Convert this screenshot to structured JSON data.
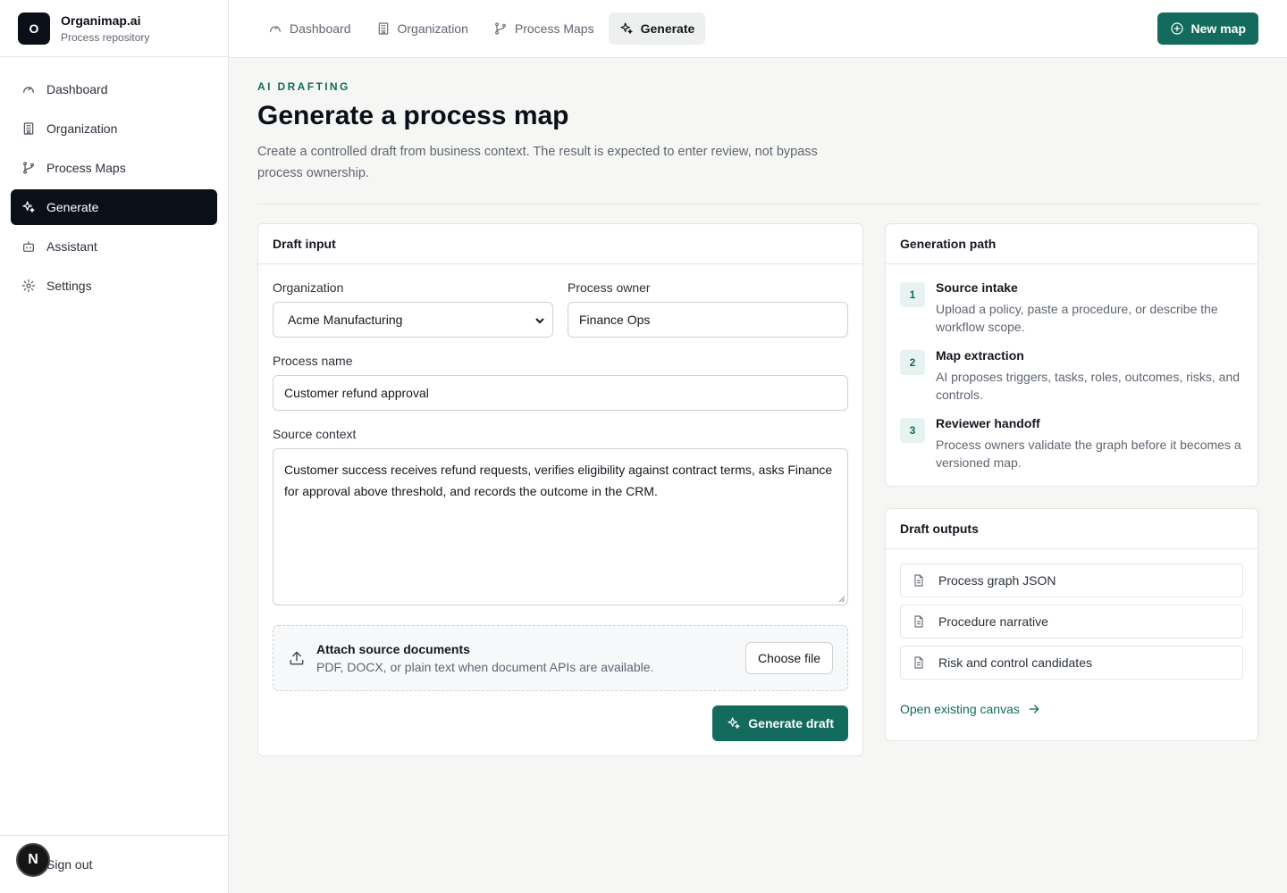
{
  "brand": {
    "logo_letter": "O",
    "name": "Organimap.ai",
    "subtitle": "Process repository"
  },
  "sidebar": {
    "items": [
      {
        "label": "Dashboard",
        "icon": "gauge-icon"
      },
      {
        "label": "Organization",
        "icon": "building-icon"
      },
      {
        "label": "Process Maps",
        "icon": "git-branch-icon"
      },
      {
        "label": "Generate",
        "icon": "sparkles-icon",
        "active": true
      },
      {
        "label": "Assistant",
        "icon": "bot-icon"
      },
      {
        "label": "Settings",
        "icon": "gear-icon"
      }
    ],
    "avatar_letter": "N",
    "sign_out": "Sign out"
  },
  "topbar": {
    "tabs": [
      {
        "label": "Dashboard",
        "icon": "gauge-icon"
      },
      {
        "label": "Organization",
        "icon": "building-icon"
      },
      {
        "label": "Process Maps",
        "icon": "git-branch-icon"
      },
      {
        "label": "Generate",
        "icon": "sparkles-icon",
        "active": true
      }
    ],
    "new_map_label": "New map"
  },
  "header": {
    "eyebrow": "AI DRAFTING",
    "title": "Generate a process map",
    "description": "Create a controlled draft from business context. The result is expected to enter review, not bypass process ownership."
  },
  "draft": {
    "title": "Draft input",
    "organization_label": "Organization",
    "organization_value": "Acme Manufacturing",
    "owner_label": "Process owner",
    "owner_value": "Finance Ops",
    "name_label": "Process name",
    "name_value": "Customer refund approval",
    "context_label": "Source context",
    "context_value": "Customer success receives refund requests, verifies eligibility against contract terms, asks Finance for approval above threshold, and records the outcome in the CRM.",
    "attach_title": "Attach source documents",
    "attach_sub": "PDF, DOCX, or plain text when document APIs are available.",
    "choose_file": "Choose file",
    "generate": "Generate draft"
  },
  "path": {
    "title": "Generation path",
    "steps": [
      {
        "num": "1",
        "title": "Source intake",
        "desc": "Upload a policy, paste a procedure, or describe the workflow scope."
      },
      {
        "num": "2",
        "title": "Map extraction",
        "desc": "AI proposes triggers, tasks, roles, outcomes, risks, and controls."
      },
      {
        "num": "3",
        "title": "Reviewer handoff",
        "desc": "Process owners validate the graph before it becomes a versioned map."
      }
    ]
  },
  "outputs": {
    "title": "Draft outputs",
    "items": [
      "Process graph JSON",
      "Procedure narrative",
      "Risk and control candidates"
    ],
    "open_link": "Open existing canvas"
  },
  "colors": {
    "accent": "#126b5c",
    "dark": "#0b0f17",
    "background": "#f6f7f5"
  }
}
